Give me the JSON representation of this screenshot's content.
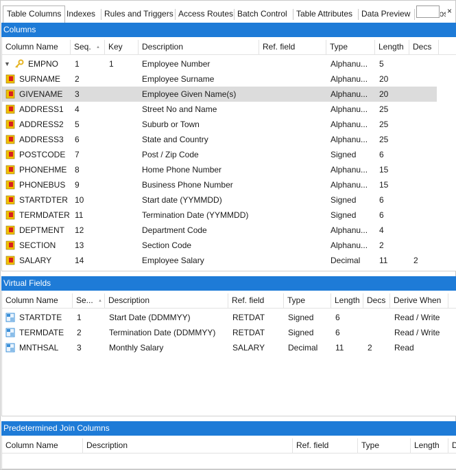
{
  "tabs": [
    {
      "label": "Table Columns",
      "active": true
    },
    {
      "label": "Indexes"
    },
    {
      "label": "Rules and Triggers"
    },
    {
      "label": "Access Routes"
    },
    {
      "label": "Batch Control"
    },
    {
      "label": "Table Attributes"
    },
    {
      "label": "Data Preview"
    }
  ],
  "tab_partial_label": "Cross",
  "tab_close_glyph": "×",
  "columns_section": {
    "title": "Columns",
    "headers": [
      "Column Name",
      "Seq.",
      "Key",
      "Description",
      "Ref. field",
      "Type",
      "Length",
      "Decs"
    ],
    "rows": [
      {
        "name": "EMPNO",
        "seq": "1",
        "key": "1",
        "desc": "Employee Number",
        "ref": "",
        "type": "Alphanu...",
        "length": "5",
        "decs": "",
        "icon": "key-icon"
      },
      {
        "name": "SURNAME",
        "seq": "2",
        "key": "",
        "desc": "Employee Surname",
        "ref": "",
        "type": "Alphanu...",
        "length": "20",
        "decs": "",
        "icon": "column-icon"
      },
      {
        "name": "GIVENAME",
        "seq": "3",
        "key": "",
        "desc": "Employee Given Name(s)",
        "ref": "",
        "type": "Alphanu...",
        "length": "20",
        "decs": "",
        "icon": "column-icon",
        "selected": true
      },
      {
        "name": "ADDRESS1",
        "seq": "4",
        "key": "",
        "desc": "Street No and Name",
        "ref": "",
        "type": "Alphanu...",
        "length": "25",
        "decs": "",
        "icon": "column-icon"
      },
      {
        "name": "ADDRESS2",
        "seq": "5",
        "key": "",
        "desc": "Suburb or Town",
        "ref": "",
        "type": "Alphanu...",
        "length": "25",
        "decs": "",
        "icon": "column-icon"
      },
      {
        "name": "ADDRESS3",
        "seq": "6",
        "key": "",
        "desc": "State and Country",
        "ref": "",
        "type": "Alphanu...",
        "length": "25",
        "decs": "",
        "icon": "column-icon"
      },
      {
        "name": "POSTCODE",
        "seq": "7",
        "key": "",
        "desc": "Post / Zip Code",
        "ref": "",
        "type": "Signed",
        "length": "6",
        "decs": "",
        "icon": "column-icon"
      },
      {
        "name": "PHONEHME",
        "seq": "8",
        "key": "",
        "desc": "Home Phone Number",
        "ref": "",
        "type": "Alphanu...",
        "length": "15",
        "decs": "",
        "icon": "column-icon"
      },
      {
        "name": "PHONEBUS",
        "seq": "9",
        "key": "",
        "desc": "Business Phone Number",
        "ref": "",
        "type": "Alphanu...",
        "length": "15",
        "decs": "",
        "icon": "column-icon"
      },
      {
        "name": "STARTDTER",
        "seq": "10",
        "key": "",
        "desc": "Start date (YYMMDD)",
        "ref": "",
        "type": "Signed",
        "length": "6",
        "decs": "",
        "icon": "column-icon"
      },
      {
        "name": "TERMDATER",
        "seq": "11",
        "key": "",
        "desc": "Termination Date (YYMMDD)",
        "ref": "",
        "type": "Signed",
        "length": "6",
        "decs": "",
        "icon": "column-icon"
      },
      {
        "name": "DEPTMENT",
        "seq": "12",
        "key": "",
        "desc": "Department Code",
        "ref": "",
        "type": "Alphanu...",
        "length": "4",
        "decs": "",
        "icon": "column-icon"
      },
      {
        "name": "SECTION",
        "seq": "13",
        "key": "",
        "desc": "Section Code",
        "ref": "",
        "type": "Alphanu...",
        "length": "2",
        "decs": "",
        "icon": "column-icon"
      },
      {
        "name": "SALARY",
        "seq": "14",
        "key": "",
        "desc": "Employee Salary",
        "ref": "",
        "type": "Decimal",
        "length": "11",
        "decs": "2",
        "icon": "column-icon"
      }
    ]
  },
  "virtual_section": {
    "title": "Virtual Fields",
    "headers": [
      "Column Name",
      "Se...",
      "Description",
      "Ref. field",
      "Type",
      "Length",
      "Decs",
      "Derive When"
    ],
    "rows": [
      {
        "name": "STARTDTE",
        "seq": "1",
        "desc": "Start Date (DDMMYY)",
        "ref": "RETDAT",
        "type": "Signed",
        "length": "6",
        "decs": "",
        "derive": "Read / Write"
      },
      {
        "name": "TERMDATE",
        "seq": "2",
        "desc": "Termination Date (DDMMYY)",
        "ref": "RETDAT",
        "type": "Signed",
        "length": "6",
        "decs": "",
        "derive": "Read / Write"
      },
      {
        "name": "MNTHSAL",
        "seq": "3",
        "desc": "Monthly Salary",
        "ref": "SALARY",
        "type": "Decimal",
        "length": "11",
        "decs": "2",
        "derive": "Read"
      }
    ]
  },
  "join_section": {
    "title": "Predetermined Join Columns",
    "headers": [
      "Column Name",
      "Description",
      "Ref. field",
      "Type",
      "Length",
      "D"
    ]
  },
  "colors": {
    "accent": "#1e7bd7",
    "selected_row": "#dcdcdc",
    "key_icon": "#e6b422",
    "column_icon_red": "#d62020",
    "column_icon_yellow": "#f2c200",
    "virtual_icon": "#3a8fd8"
  }
}
